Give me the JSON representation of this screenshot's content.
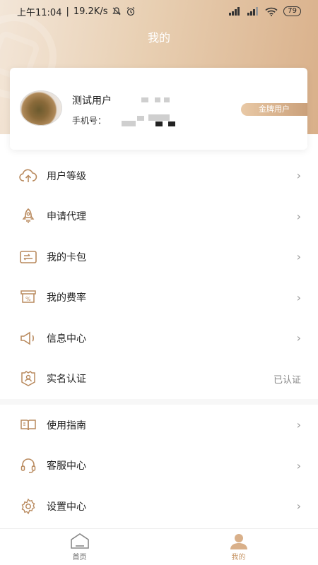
{
  "status_bar": {
    "time": "上午11:04",
    "speed": "19.2K/s",
    "battery": "79"
  },
  "header": {
    "title": "我的"
  },
  "profile": {
    "name": "测试用户",
    "phone_label": "手机号：",
    "badge": "金牌用户"
  },
  "menu_group1": [
    {
      "label": "用户等级",
      "icon": "cloud-upload-icon",
      "trailing": "›"
    },
    {
      "label": "申请代理",
      "icon": "rocket-icon",
      "trailing": "›"
    },
    {
      "label": "我的卡包",
      "icon": "wallet-icon",
      "trailing": "›"
    },
    {
      "label": "我的费率",
      "icon": "percent-ticket-icon",
      "trailing": "›"
    },
    {
      "label": "信息中心",
      "icon": "megaphone-icon",
      "trailing": "›"
    },
    {
      "label": "实名认证",
      "icon": "id-badge-icon",
      "trailing": "已认证"
    }
  ],
  "menu_group2": [
    {
      "label": "使用指南",
      "icon": "book-icon",
      "trailing": "›"
    },
    {
      "label": "客服中心",
      "icon": "headset-icon",
      "trailing": "›"
    },
    {
      "label": "设置中心",
      "icon": "gear-icon",
      "trailing": "›"
    }
  ],
  "tab_bar": [
    {
      "label": "首页",
      "icon": "home-icon"
    },
    {
      "label": "我的",
      "icon": "user-icon"
    }
  ],
  "colors": {
    "accent": "#c9996a",
    "header_start": "#f3e6d8",
    "header_end": "#d9b08a"
  }
}
